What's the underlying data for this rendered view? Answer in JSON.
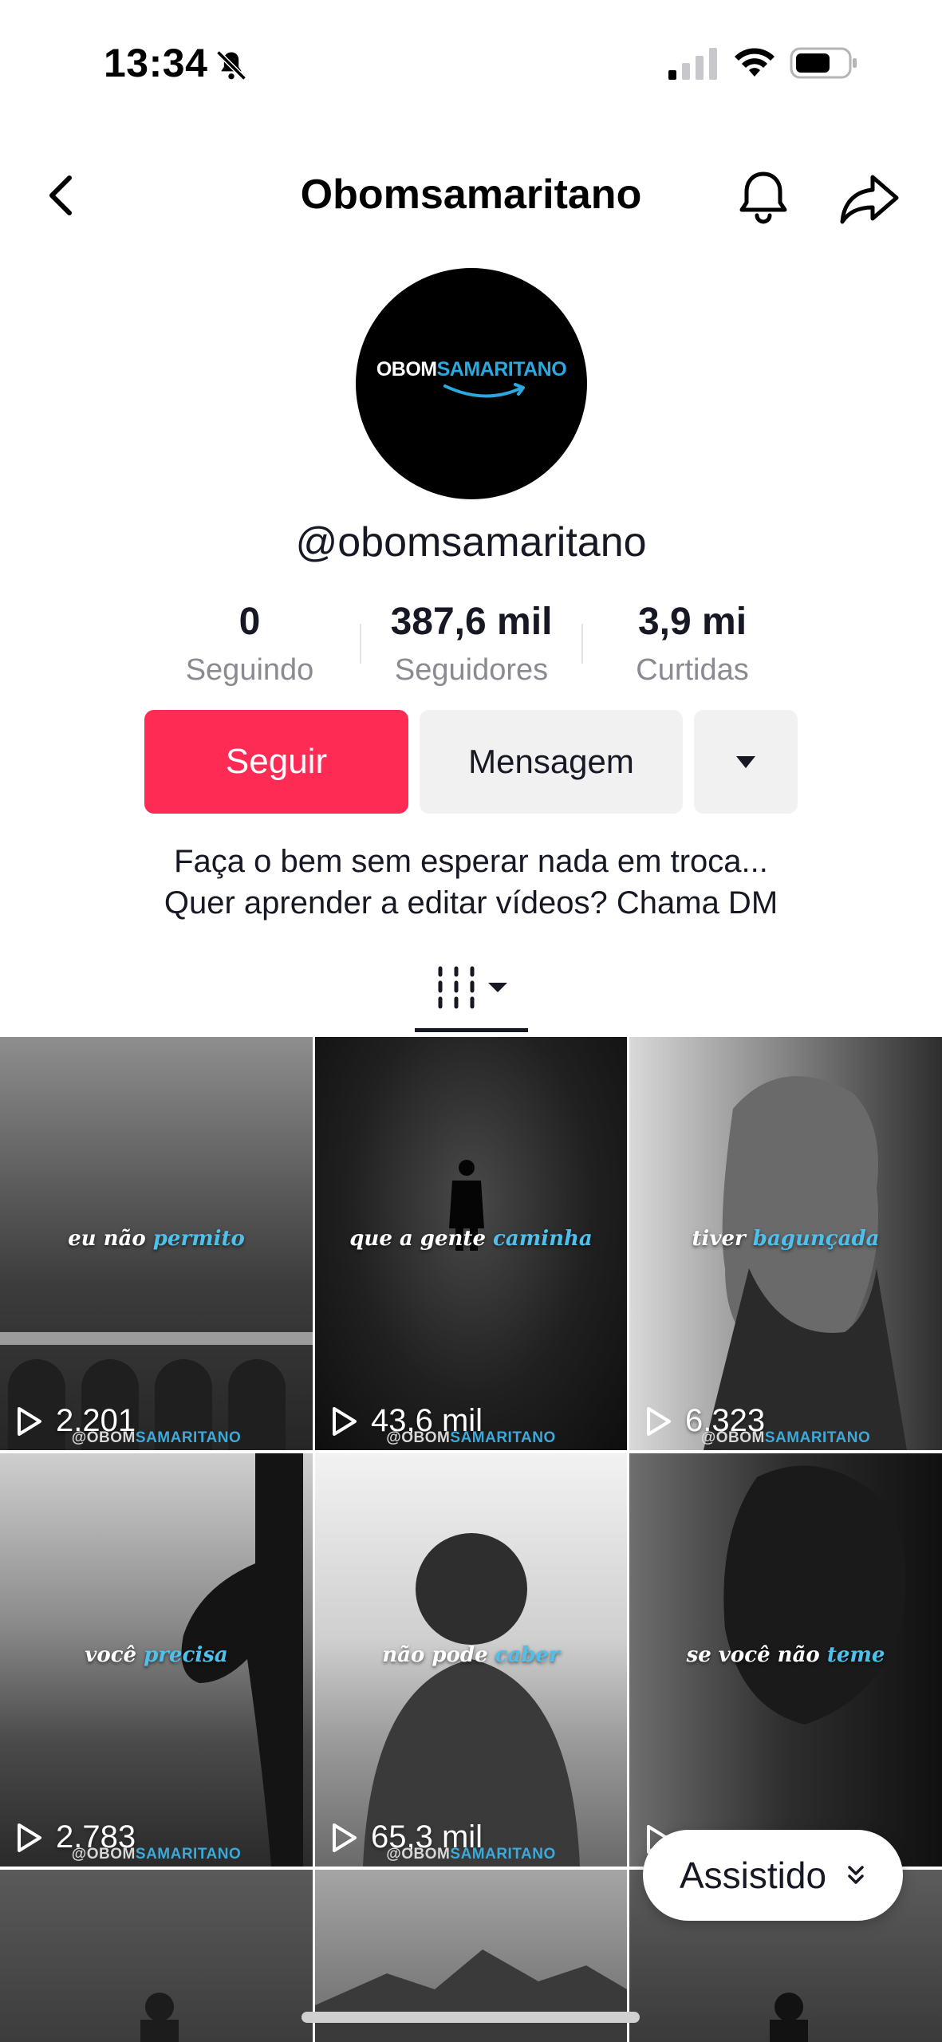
{
  "status_bar": {
    "time": "13:34"
  },
  "header": {
    "title": "Obomsamaritano"
  },
  "profile": {
    "avatar_logo_part1": "OBOM",
    "avatar_logo_part2": "SAMARITANO",
    "username": "@obomsamaritano",
    "bio_line1": "Faça o bem sem esperar nada em troca...",
    "bio_line2": "Quer aprender a editar vídeos? Chama DM"
  },
  "stats": [
    {
      "value": "0",
      "label": "Seguindo"
    },
    {
      "value": "387,6 mil",
      "label": "Seguidores"
    },
    {
      "value": "3,9 mi",
      "label": "Curtidas"
    }
  ],
  "actions": {
    "follow": "Seguir",
    "message": "Mensagem"
  },
  "videos": [
    {
      "caption_a": "eu não ",
      "caption_b": "permito",
      "views": "2.201"
    },
    {
      "caption_a": "que a gente ",
      "caption_b": "caminha",
      "views": "43,6 mil"
    },
    {
      "caption_a": "tiver ",
      "caption_b": "bagunçada",
      "views": "6.323"
    },
    {
      "caption_a": "você ",
      "caption_b": "precisa",
      "views": "2.783"
    },
    {
      "caption_a": "não pode ",
      "caption_b": "caber",
      "views": "65,3 mil"
    },
    {
      "caption_a": "se você não ",
      "caption_b": "teme",
      "views": ""
    }
  ],
  "watermark": {
    "part1": "@OBOM",
    "part2": "SAMARITANO"
  },
  "watched_pill": "Assistido",
  "colors": {
    "accent": "#fe2c55",
    "brand_blue": "#2aa9e0"
  }
}
